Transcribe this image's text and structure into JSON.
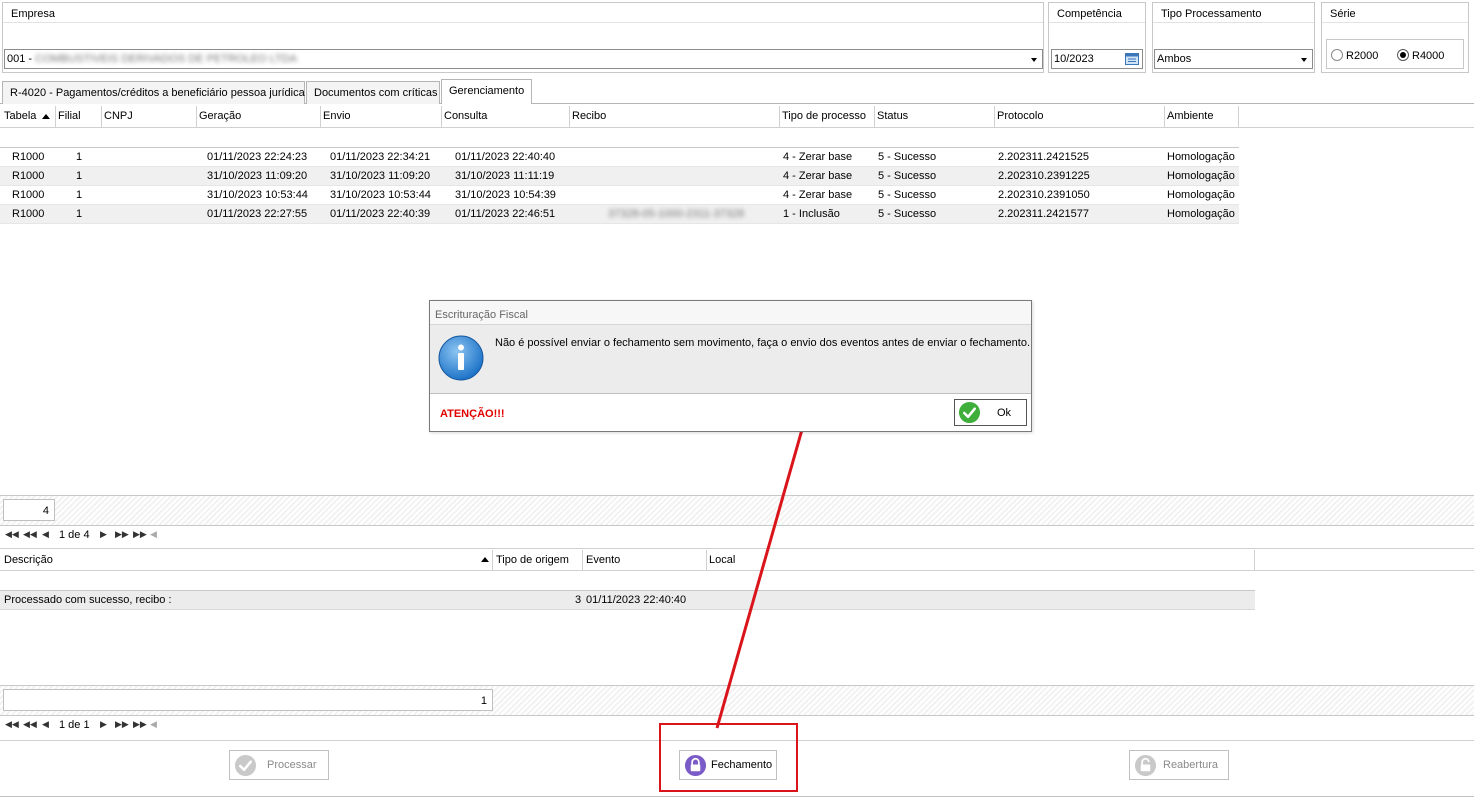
{
  "filters": {
    "empresa": {
      "label": "Empresa",
      "value": "001 - COMBUSTIVEIS DERIVADOS DE PETROLEO LTDA"
    },
    "competencia": {
      "label": "Competência",
      "value": "10/2023"
    },
    "tipo_processamento": {
      "label": "Tipo Processamento",
      "value": "Ambos"
    },
    "serie": {
      "label": "Série",
      "options": [
        "R2000",
        "R4000"
      ],
      "selected": "R4000"
    }
  },
  "tabs": [
    {
      "label": "R-4020 - Pagamentos/créditos a beneficiário pessoa jurídica",
      "active": false
    },
    {
      "label": "Documentos com críticas",
      "active": false
    },
    {
      "label": "Gerenciamento",
      "active": true
    }
  ],
  "main_grid": {
    "columns": [
      "Tabela",
      "Filial",
      "CNPJ",
      "Geração",
      "Envio",
      "Consulta",
      "Recibo",
      "Tipo de processo",
      "Status",
      "Protocolo",
      "Ambiente"
    ],
    "rows": [
      {
        "tabela": "R1000",
        "filial": "1",
        "cnpj": "",
        "geracao": "01/11/2023 22:24:23",
        "envio": "01/11/2023 22:34:21",
        "consulta": "01/11/2023 22:40:40",
        "recibo": "",
        "tipo": "4 - Zerar base",
        "status": "5 - Sucesso",
        "protocolo": "2.202311.2421525",
        "ambiente": "Homologação"
      },
      {
        "tabela": "R1000",
        "filial": "1",
        "cnpj": "",
        "geracao": "31/10/2023 11:09:20",
        "envio": "31/10/2023 11:09:20",
        "consulta": "31/10/2023 11:11:19",
        "recibo": "",
        "tipo": "4 - Zerar base",
        "status": "5 - Sucesso",
        "protocolo": "2.202310.2391225",
        "ambiente": "Homologação"
      },
      {
        "tabela": "R1000",
        "filial": "1",
        "cnpj": "",
        "geracao": "31/10/2023 10:53:44",
        "envio": "31/10/2023 10:53:44",
        "consulta": "31/10/2023 10:54:39",
        "recibo": "",
        "tipo": "4 - Zerar base",
        "status": "5 - Sucesso",
        "protocolo": "2.202310.2391050",
        "ambiente": "Homologação"
      },
      {
        "tabela": "R1000",
        "filial": "1",
        "cnpj": "",
        "geracao": "01/11/2023 22:27:55",
        "envio": "01/11/2023 22:40:39",
        "consulta": "01/11/2023 22:46:51",
        "recibo": "37328-05-1000-2311-37328",
        "tipo": "1 - Inclusão",
        "status": "5 - Sucesso",
        "protocolo": "2.202311.2421577",
        "ambiente": "Homologação"
      }
    ],
    "count": "4",
    "pager": "1 de 4"
  },
  "detail_grid": {
    "columns": [
      "Descrição",
      "Tipo de origem",
      "Evento",
      "Local"
    ],
    "rows": [
      {
        "descricao": "Processado com sucesso, recibo :",
        "tipo_origem": "3",
        "evento": "01/11/2023 22:40:40",
        "local": ""
      }
    ],
    "count": "1",
    "pager": "1 de 1"
  },
  "dialog": {
    "title": "Escrituração Fiscal",
    "message": "Não é possível enviar o fechamento sem movimento, faça o envio dos eventos antes de enviar o fechamento.",
    "warning": "ATENÇÃO!!!",
    "ok_label": "Ok",
    "icon": "info-icon"
  },
  "actions": {
    "processar": "Processar",
    "fechamento": "Fechamento",
    "reabertura": "Reabertura"
  },
  "colors": {
    "annotation_red": "#d9141b",
    "warning_red": "#e00000",
    "info_blue": "#1e74c8"
  }
}
